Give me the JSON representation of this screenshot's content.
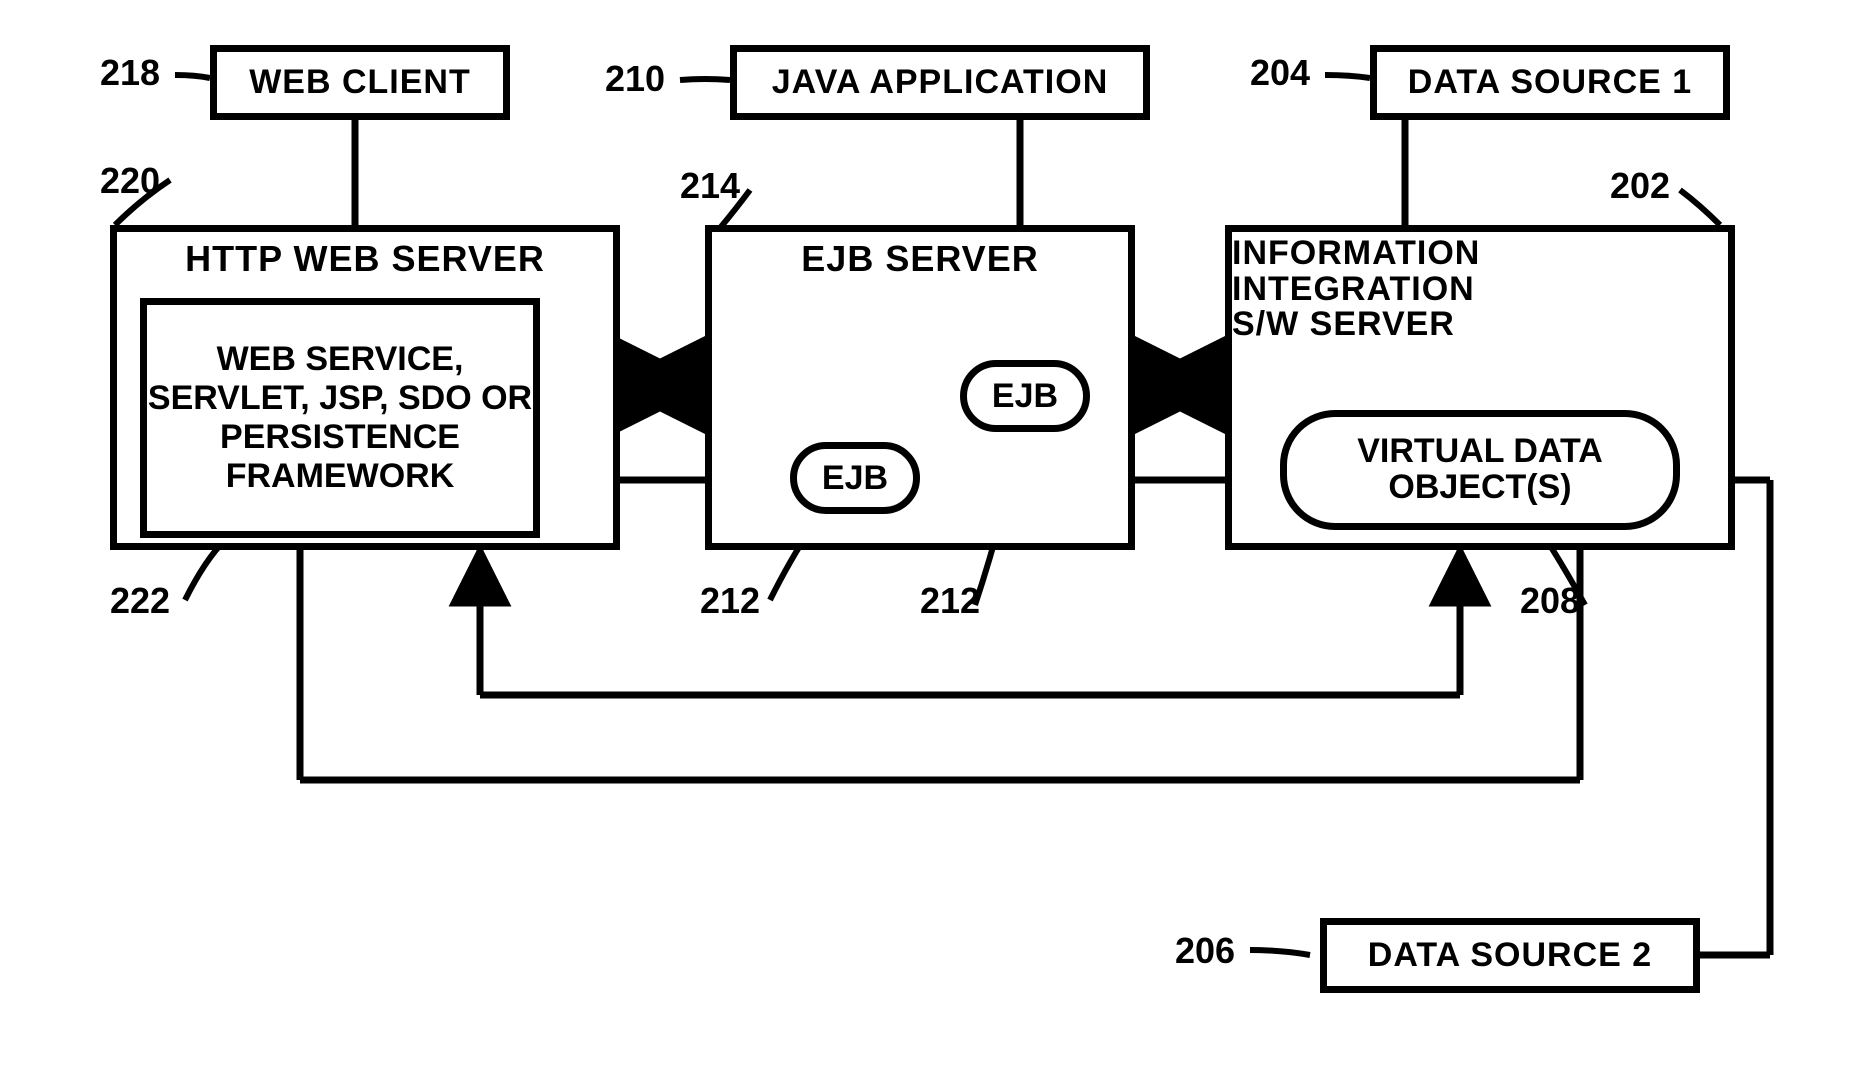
{
  "refs": {
    "r218": "218",
    "r220": "220",
    "r222": "222",
    "r210": "210",
    "r214": "214",
    "r212a": "212",
    "r212b": "212",
    "r204": "204",
    "r202": "202",
    "r208": "208",
    "r206": "206"
  },
  "boxes": {
    "web_client": "WEB CLIENT",
    "java_app": "JAVA APPLICATION",
    "data_source_1": "DATA SOURCE 1",
    "data_source_2": "DATA SOURCE 2"
  },
  "servers": {
    "http_title": "HTTP WEB SERVER",
    "http_inner": "WEB SERVICE, SERVLET, JSP, SDO OR PERSISTENCE FRAMEWORK",
    "ejb_title": "EJB SERVER",
    "ejb_pill": "EJB",
    "iis_title_line1": "INFORMATION",
    "iis_title_line2": "INTEGRATION",
    "iis_title_line3": "S/W SERVER",
    "vdo_pill_line1": "VIRTUAL DATA",
    "vdo_pill_line2": "OBJECT(S)"
  }
}
